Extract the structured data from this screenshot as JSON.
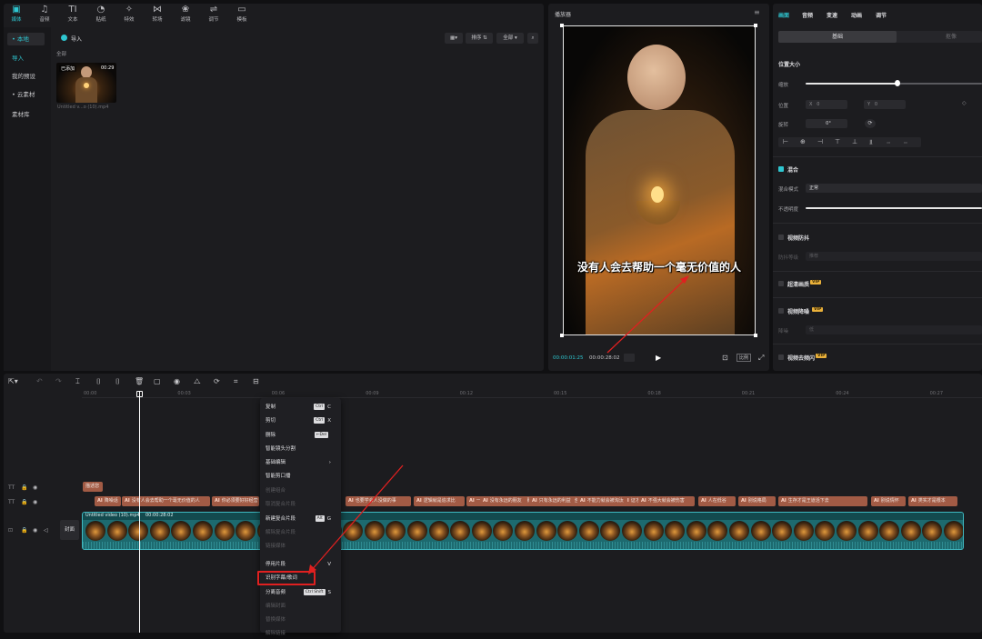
{
  "toolbar": {
    "items": [
      {
        "label": "媒体",
        "icon": "media-icon"
      },
      {
        "label": "音频",
        "icon": "audio-icon"
      },
      {
        "label": "文本",
        "icon": "text-icon"
      },
      {
        "label": "贴纸",
        "icon": "sticker-icon"
      },
      {
        "label": "特效",
        "icon": "effects-icon"
      },
      {
        "label": "转场",
        "icon": "transition-icon"
      },
      {
        "label": "滤镜",
        "icon": "filter-icon"
      },
      {
        "label": "调节",
        "icon": "adjust-icon"
      },
      {
        "label": "模板",
        "icon": "template-icon"
      }
    ],
    "glyphs": [
      "▣",
      "♫",
      "TI",
      "◔",
      "✧",
      "⋈",
      "❀",
      "⇌",
      "▭"
    ]
  },
  "sidebar": {
    "items": [
      {
        "label": "• 本地",
        "active": true
      },
      {
        "label": "导入",
        "active": false,
        "accent": true
      },
      {
        "label": "我的预设",
        "active": false
      },
      {
        "label": "• 云素材",
        "active": false
      },
      {
        "label": "素材库",
        "active": false
      }
    ]
  },
  "media": {
    "import_label": "导入",
    "filter_all": "全部",
    "sort_label": "排序 ⇅",
    "all_label": "全部 ▾",
    "section_label": "全部",
    "thumb_badge": "已添加",
    "thumb_duration": "00:29",
    "thumb_name": "Untitled v...o (10).mp4"
  },
  "player": {
    "title": "播放器",
    "subtitle": "没有人会去帮助一个毫无价值的人",
    "time_current": "00:00:01:25",
    "time_total": "00:00:28:02",
    "ratio": "比例"
  },
  "props": {
    "tabs": [
      "画面",
      "音频",
      "变速",
      "动画",
      "调节"
    ],
    "subtabs": [
      "基础",
      "抠像"
    ],
    "position_size": "位置大小",
    "scale": "缩放",
    "scale_value": 0.52,
    "position": "位置",
    "x_label": "X",
    "x_value": "0",
    "y_label": "Y",
    "y_value": "0",
    "rotate": "旋转",
    "rotate_value": "0°",
    "blend": "混合",
    "blend_mode_label": "混合模式",
    "blend_mode_value": "正常",
    "opacity": "不透明度",
    "stabilize": "视频防抖",
    "stabilize_level_label": "防抖等级",
    "stabilize_level_value": "推荐",
    "hd": "超清画质",
    "noise": "视频降噪",
    "noise_level_label": "降噪",
    "noise_level_value": "低",
    "deflicker": "视频去频闪",
    "vip": "VIP"
  },
  "timeline": {
    "ticks": [
      "00:00",
      "00:03",
      "00:06",
      "00:09",
      "00:12",
      "00:15",
      "00:18",
      "00:21",
      "00:24",
      "00:27"
    ],
    "text_clip_top": "描述您",
    "text_clips": [
      "AI 降噪话",
      "AI 没有人会去帮助一个毫无价值的人",
      "AI 你必须要好好经营",
      "AI 也要学会做",
      "AI 包括那些人当",
      "AI 放弃",
      "AI 也要学会人没做的事",
      "AI 逻辑就是追求比",
      "AI 一个价值的人",
      "AI 你也",
      "AI 我们和那些仪式当",
      "AI 是",
      "AI 也要学会在现场观的概括",
      "AI 证才是描述容器",
      "AI 没有永远的朋友",
      "AI 只有永远的利益",
      "AI 不能力就会被淘汰",
      "AI 不强大就会被伤害",
      "AI 人在低谷",
      "AI 别说格局",
      "AI 生存才是王道活下去",
      "AI 别说情怀",
      "AI 类实才是根本"
    ],
    "video_clip_name": "Untitled video (10).mp4",
    "video_clip_duration": "00:00:28:02",
    "cover_label": "封面",
    "track_icons": [
      "TT",
      "TT",
      "⊡"
    ]
  },
  "context_menu": {
    "items": [
      {
        "label": "复制",
        "key": "Ctrl",
        "letter": "C",
        "disabled": false
      },
      {
        "label": "剪切",
        "key": "Ctrl",
        "letter": "X",
        "disabled": false
      },
      {
        "label": "删除",
        "key": "←Del",
        "letter": "",
        "disabled": false
      },
      {
        "label": "智能镜头分割",
        "key": "",
        "letter": "",
        "disabled": false
      },
      {
        "label": "基础编辑",
        "key": "",
        "letter": "›",
        "disabled": false
      },
      {
        "label": "智能剪口播",
        "key": "",
        "letter": "",
        "disabled": false
      },
      {
        "label": "创建组合",
        "key": "",
        "letter": "",
        "disabled": true
      },
      {
        "label": "取消复合片段",
        "key": "",
        "letter": "",
        "disabled": true
      },
      {
        "label": "新建复合片段",
        "key": "Alt",
        "letter": "G",
        "disabled": false
      },
      {
        "label": "解除复合片段",
        "key": "",
        "letter": "",
        "disabled": true
      },
      {
        "label": "链接媒体",
        "key": "",
        "letter": "",
        "disabled": true
      },
      {
        "label": "停用片段",
        "key": "",
        "letter": "V",
        "disabled": false
      },
      {
        "label": "识别字幕/歌词",
        "key": "",
        "letter": "",
        "disabled": false
      },
      {
        "label": "分离音频",
        "key": "Ctrl Shift",
        "letter": "S",
        "disabled": false
      },
      {
        "label": "编辑封面",
        "key": "",
        "letter": "",
        "disabled": true
      },
      {
        "label": "替换媒体",
        "key": "",
        "letter": "",
        "disabled": true
      },
      {
        "label": "解除链接",
        "key": "",
        "letter": "",
        "disabled": true
      }
    ]
  },
  "colors": {
    "accent": "#2ec6d0",
    "clip": "#a25b45",
    "video": "#1d6a6f",
    "highlight": "#e02020"
  }
}
